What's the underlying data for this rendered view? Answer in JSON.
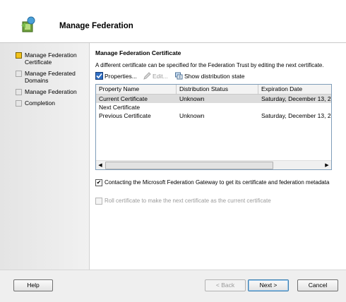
{
  "header": {
    "title": "Manage Federation"
  },
  "nav": {
    "items": [
      {
        "label": "Manage Federation Certificate",
        "state": "current"
      },
      {
        "label": "Manage Federated Domains",
        "state": "pending"
      },
      {
        "label": "Manage Federation",
        "state": "pending"
      },
      {
        "label": "Completion",
        "state": "pending"
      }
    ]
  },
  "main": {
    "section_title": "Manage Federation Certificate",
    "description": "A different certificate can be specified for the Federation Trust by editing the next certificate.",
    "toolbar": {
      "properties": "Properties...",
      "edit": "Edit...",
      "show_distribution": "Show distribution state"
    },
    "table": {
      "columns": [
        "Property Name",
        "Distribution Status",
        "Expiration Date"
      ],
      "rows": [
        [
          "Current Certificate",
          "Unknown",
          "Saturday, December 13, 2..."
        ],
        [
          "Next Certificate",
          "",
          ""
        ],
        [
          "Previous Certificate",
          "Unknown",
          "Saturday, December 13, 2..."
        ]
      ],
      "selected_row": 0
    },
    "checkbox_gateway": {
      "label": "Contacting the Microsoft Federation Gateway to get its certificate and federation metadata",
      "checked": true
    },
    "checkbox_roll": {
      "label": "Roll certificate to make the next certificate as the current certificate",
      "checked": false,
      "enabled": false
    }
  },
  "footer": {
    "help": "Help",
    "back": "< Back",
    "next": "Next >",
    "cancel": "Cancel"
  },
  "colors": {
    "current_step": "#f2c21a",
    "selected_row": "#dcdcdc",
    "disabled_text": "#9a9a9a"
  }
}
